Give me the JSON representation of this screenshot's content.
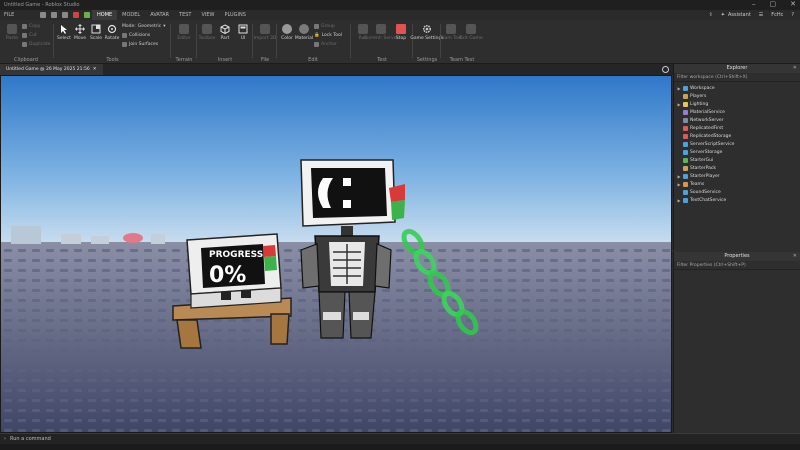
{
  "window": {
    "title": "Untitled Game - Roblox Studio",
    "controls": [
      "–",
      "▢",
      "✕"
    ]
  },
  "menu": {
    "file": "FILE",
    "tabs": [
      "HOME",
      "MODEL",
      "AVATAR",
      "TEST",
      "VIEW",
      "PLUGINS"
    ],
    "active_tab": "HOME",
    "assistant": "Assistant",
    "user": "FcHc"
  },
  "ribbon": {
    "clipboard": {
      "label": "Clipboard",
      "paste": "Paste",
      "copy": "Copy",
      "cut": "Cut",
      "duplicate": "Duplicate"
    },
    "tools": {
      "label": "Tools",
      "select": "Select",
      "move": "Move",
      "scale": "Scale",
      "rotate": "Rotate",
      "mode_label": "Mode:",
      "mode_value": "Geometric",
      "collisions": "Collisions",
      "join_surfaces": "Join Surfaces"
    },
    "terrain": {
      "label": "Terrain",
      "editor": "Editor"
    },
    "insert": {
      "label": "Insert",
      "toolbox": "Toolbox",
      "part": "Part",
      "ui": "UI"
    },
    "file": {
      "label": "File",
      "import_3d": "Import 3D"
    },
    "edit": {
      "label": "Edit",
      "color": "Color",
      "material": "Material",
      "group": "Group",
      "lock": "Lock Tool",
      "anchor": "Anchor"
    },
    "test": {
      "label": "Test",
      "run": "Run",
      "current_server": "Current: Server",
      "stop": "Stop"
    },
    "settings": {
      "label": "Settings",
      "game_settings": "Game Settings"
    },
    "team_test": {
      "label": "Team Test",
      "team_test": "Team Test",
      "exit_game": "Exit Game"
    }
  },
  "document": {
    "tab_title": "Untitled Game @ 26 May 2025 21:56",
    "close": "✕"
  },
  "scene": {
    "progress_title": "PROGRESS",
    "progress_value": "0%"
  },
  "explorer": {
    "title": "Explorer",
    "filter_placeholder": "Filter workspace (Ctrl+Shift+X)",
    "items": [
      {
        "label": "Workspace",
        "expandable": true,
        "color": "#4aa3df"
      },
      {
        "label": "Players",
        "expandable": false,
        "color": "#c7a35a"
      },
      {
        "label": "Lighting",
        "expandable": true,
        "color": "#e6c84a"
      },
      {
        "label": "MaterialService",
        "expandable": false,
        "color": "#9a7ad6"
      },
      {
        "label": "NetworkServer",
        "expandable": false,
        "color": "#7a8fa6"
      },
      {
        "label": "ReplicatedFirst",
        "expandable": false,
        "color": "#d95b5b"
      },
      {
        "label": "ReplicatedStorage",
        "expandable": false,
        "color": "#d95b5b"
      },
      {
        "label": "ServerScriptService",
        "expandable": false,
        "color": "#4aa3df"
      },
      {
        "label": "ServerStorage",
        "expandable": false,
        "color": "#4aa3df"
      },
      {
        "label": "StarterGui",
        "expandable": false,
        "color": "#5ab45a"
      },
      {
        "label": "StarterPack",
        "expandable": false,
        "color": "#c7a35a"
      },
      {
        "label": "StarterPlayer",
        "expandable": true,
        "color": "#4aa3df"
      },
      {
        "label": "Teams",
        "expandable": true,
        "color": "#d9964a"
      },
      {
        "label": "SoundService",
        "expandable": false,
        "color": "#4aa3df"
      },
      {
        "label": "TextChatService",
        "expandable": true,
        "color": "#4aa3df"
      }
    ]
  },
  "properties": {
    "title": "Properties",
    "filter_placeholder": "Filter Properties (Ctrl+Shift+P)"
  },
  "command_bar": {
    "placeholder": "Run a command"
  }
}
